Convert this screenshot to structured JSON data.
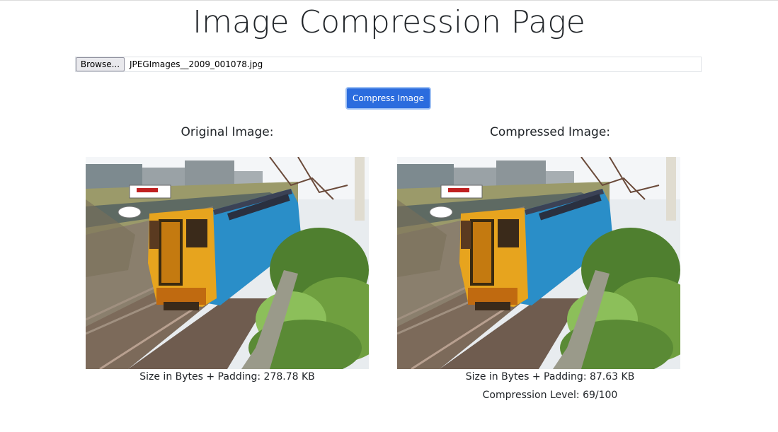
{
  "page": {
    "title": "Image Compression Page"
  },
  "file_input": {
    "browse_label": "Browse...",
    "file_name": "JPEGImages__2009_001078.jpg"
  },
  "actions": {
    "compress_label": "Compress Image"
  },
  "original": {
    "heading": "Original Image:",
    "size_text": "Size in Bytes + Padding: 278.78 KB"
  },
  "compressed": {
    "heading": "Compressed Image:",
    "size_text": "Size in Bytes + Padding: 87.63 KB",
    "level_text": "Compression Level: 69/100"
  },
  "colors": {
    "primary": "#2b6cde",
    "text": "#212529"
  }
}
